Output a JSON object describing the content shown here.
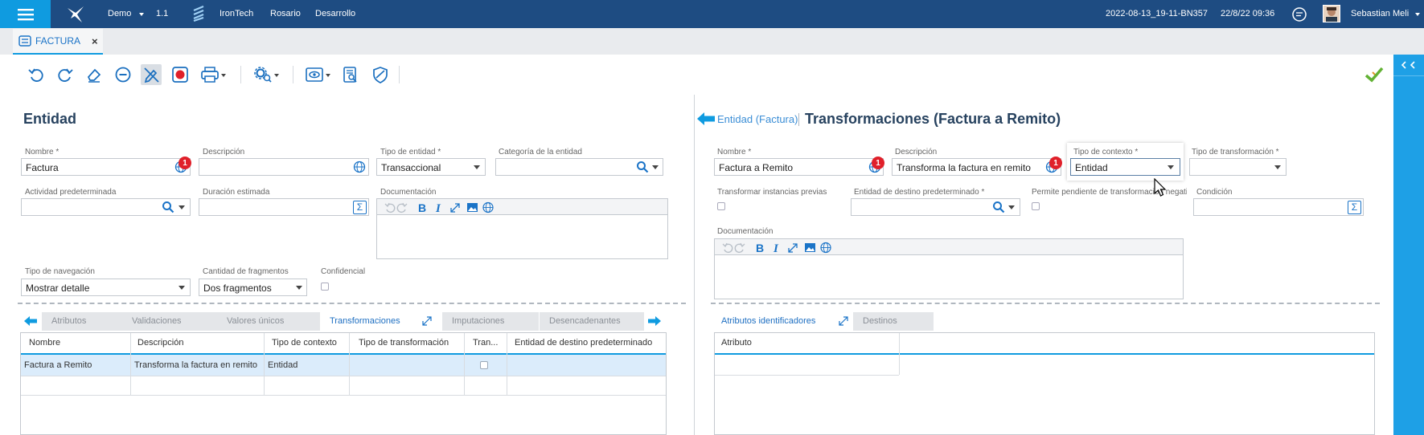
{
  "topbar": {
    "env": "Demo",
    "version": "1.1",
    "company": "IronTech",
    "city": "Rosario",
    "stage": "Desarrollo",
    "build": "2022-08-13_19-11-BN357",
    "datetime": "22/8/22 09:36",
    "user": "Sebastian Meli"
  },
  "tab": {
    "label": "FACTURA",
    "close": "×"
  },
  "toolbar": {
    "icons": [
      "undo-icon",
      "redo-icon",
      "eraser-icon",
      "minus-circle-icon",
      "edit-off-icon",
      "record-icon",
      "print-icon",
      "settings-search-icon",
      "view-icon",
      "document-search-icon",
      "shield-icon",
      "check-icon"
    ]
  },
  "left": {
    "title": "Entidad",
    "nombre_label": "Nombre *",
    "nombre_value": "Factura",
    "nombre_badge": "1",
    "descripcion_label": "Descripción",
    "descripcion_value": "",
    "tipo_entidad_label": "Tipo de entidad *",
    "tipo_entidad_value": "Transaccional",
    "categoria_label": "Categoría de la entidad",
    "actividad_label": "Actividad predeterminada",
    "duracion_label": "Duración estimada",
    "documentacion_label": "Documentación",
    "tipo_nav_label": "Tipo de navegación",
    "tipo_nav_value": "Mostrar detalle",
    "cant_frag_label": "Cantidad de fragmentos",
    "cant_frag_value": "Dos fragmentos",
    "confidencial_label": "Confidencial",
    "tabs": [
      "Atributos",
      "Validaciones",
      "Valores únicos",
      "Transformaciones",
      "Imputaciones",
      "Desencadenantes"
    ],
    "active_tab": "Transformaciones",
    "grid": {
      "headers": [
        "Nombre",
        "Descripción",
        "Tipo de contexto",
        "Tipo de transformación",
        "Tran...",
        "Entidad de destino predeterminado"
      ],
      "rows": [
        [
          "Factura a Remito",
          "Transforma la factura en remito",
          "Entidad",
          "",
          "",
          ""
        ]
      ]
    }
  },
  "right": {
    "back_link": "Entidad (Factura)",
    "title": "Transformaciones (Factura a Remito)",
    "nombre_label": "Nombre *",
    "nombre_value": "Factura a Remito",
    "nombre_badge": "1",
    "descripcion_label": "Descripción",
    "descripcion_value": "Transforma la factura en remito",
    "descripcion_badge": "1",
    "tipo_contexto_label": "Tipo de contexto *",
    "tipo_contexto_value": "Entidad",
    "tipo_transf_label": "Tipo de transformación *",
    "transformar_label": "Transformar instancias previas",
    "entidad_destino_label": "Entidad de destino predeterminado *",
    "permite_label": "Permite pendiente de transformación negativo",
    "condicion_label": "Condición",
    "documentacion_label": "Documentación",
    "tabs": [
      "Atributos identificadores",
      "Destinos"
    ],
    "active_tab": "Atributos identificadores",
    "grid": {
      "headers": [
        "Atributo"
      ]
    }
  },
  "colors": {
    "topbar": "#1e4c82",
    "accent": "#0f9be0",
    "rail": "#1ea0e6",
    "badge": "#e0202a"
  }
}
